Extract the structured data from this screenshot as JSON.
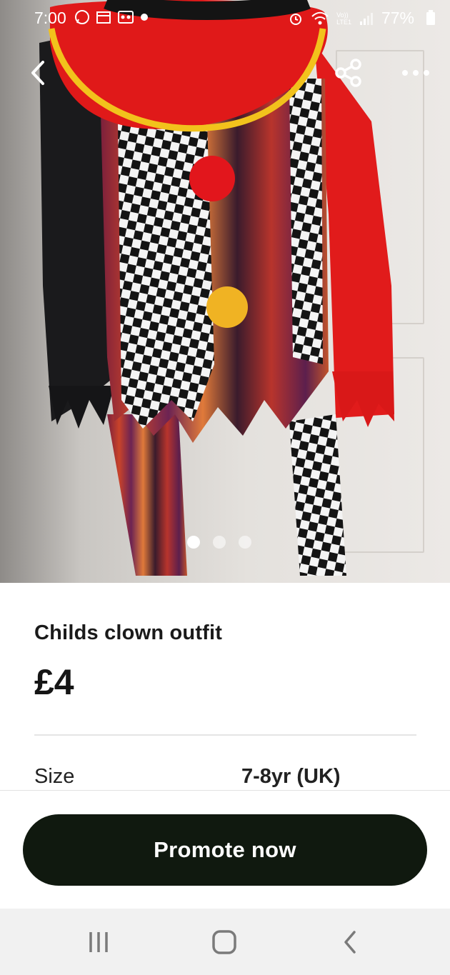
{
  "status_bar": {
    "time": "7:00",
    "battery": "77%",
    "left_icons": [
      "whatsapp-icon",
      "calendar-icon",
      "voicemail-icon",
      "dot-icon"
    ],
    "right_icons": [
      "alarm-icon",
      "wifi-icon",
      "volte-icon",
      "signal-icon",
      "battery-icon"
    ],
    "network_label_top": "Vo))",
    "network_label_bottom": "LTE1"
  },
  "top_bar": {
    "back_icon": "chevron-left-icon",
    "share_icon": "share-icon",
    "more_icon": "more-horizontal-icon"
  },
  "gallery": {
    "image_count": 3,
    "active_index": 0
  },
  "listing": {
    "title": "Childs clown outfit",
    "price": "£4",
    "attributes": [
      {
        "label": "Size",
        "value": "7-8yr (UK)"
      }
    ]
  },
  "actions": {
    "promote_label": "Promote now"
  },
  "system_nav": {
    "recents_icon": "recents-icon",
    "home_icon": "home-icon",
    "back_icon": "back-icon"
  },
  "colors": {
    "button_bg": "#10190f",
    "text_dark": "#151515"
  }
}
